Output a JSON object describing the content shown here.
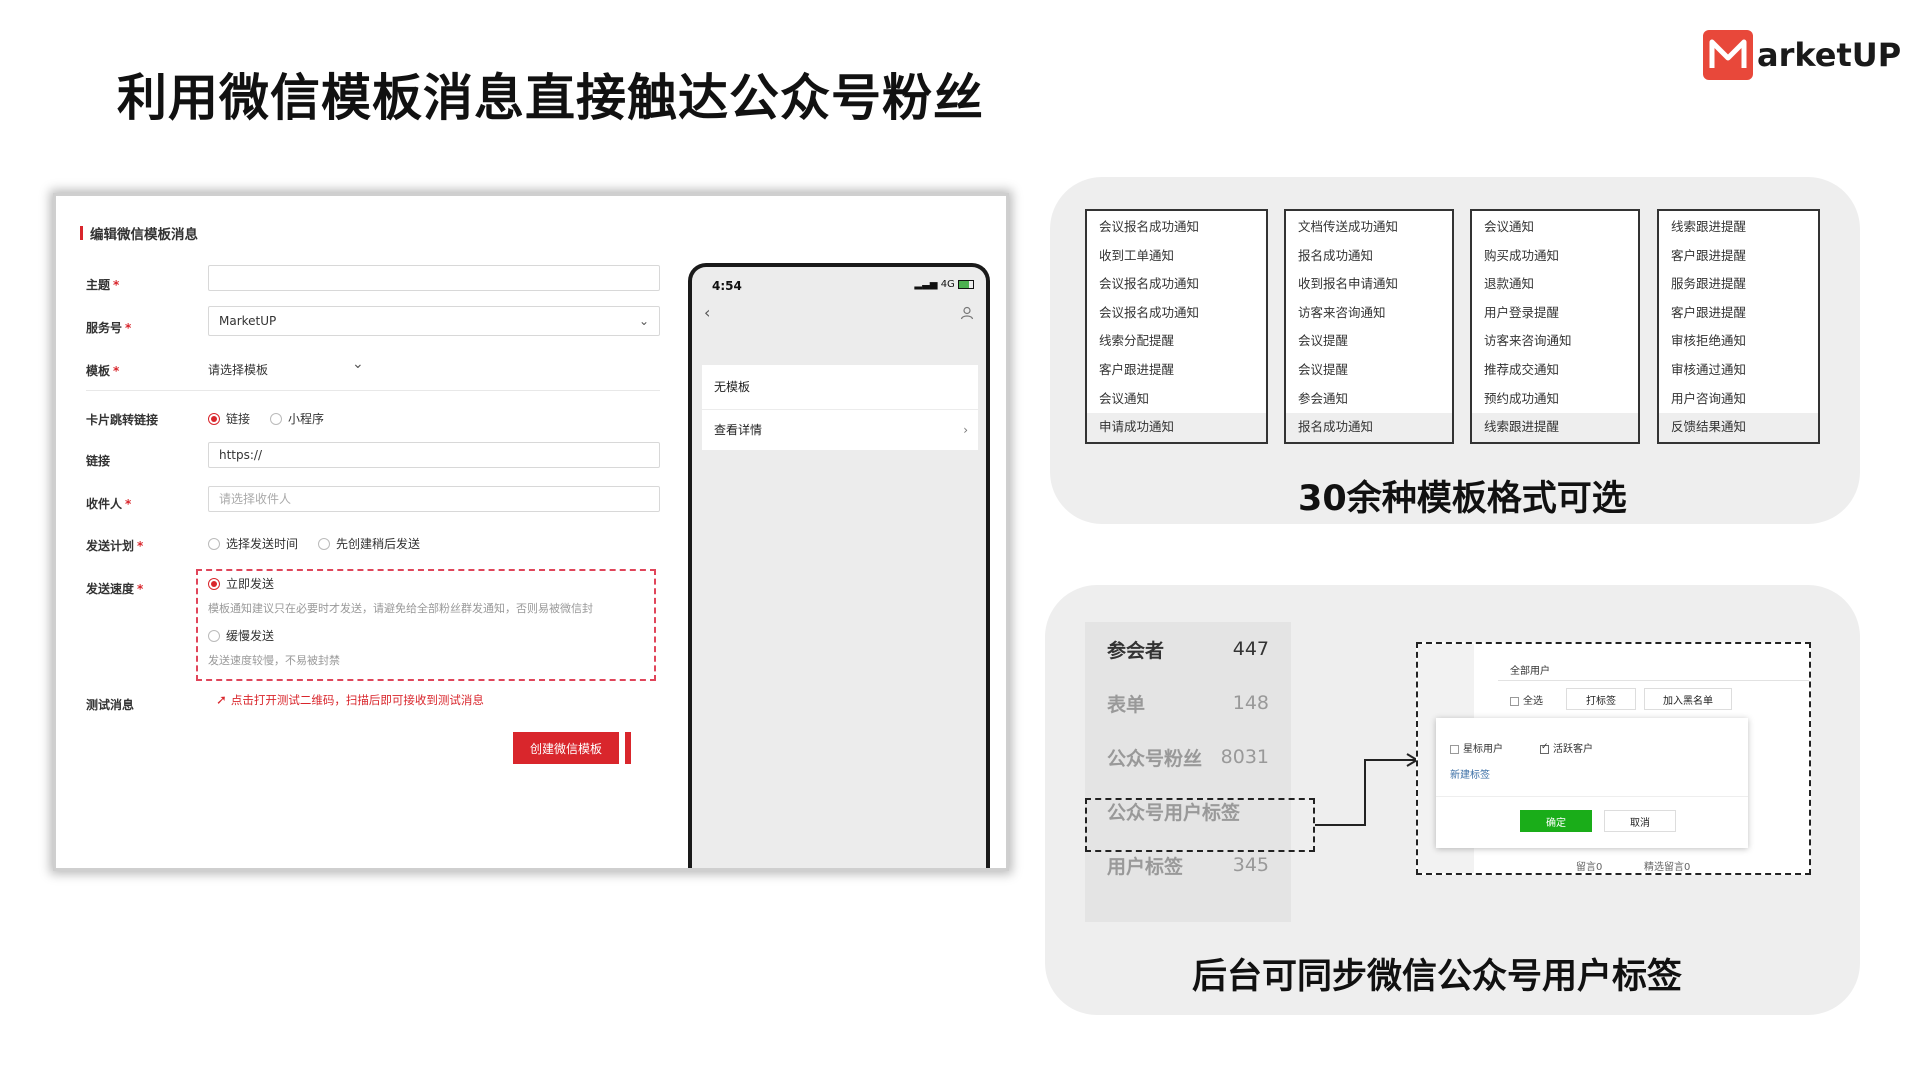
{
  "title": "利用微信模板消息直接触达公众号粉丝",
  "logo": {
    "text": "arketUP",
    "brand_color": "#e8483a"
  },
  "form": {
    "title": "编辑微信模板消息",
    "subject_label": "主题",
    "service_label": "服务号",
    "service_value": "MarketUP",
    "template_label": "模板",
    "template_value": "请选择模板",
    "jump_label": "卡片跳转链接",
    "jump_opt1": "链接",
    "jump_opt2": "小程序",
    "link_label": "链接",
    "link_value": "https://",
    "recipient_label": "收件人",
    "recipient_placeholder": "请选择收件人",
    "plan_label": "发送计划",
    "plan_opt1": "选择发送时间",
    "plan_opt2": "先创建稍后发送",
    "speed_label": "发送速度",
    "speed_opt1": "立即发送",
    "speed_hint1": "模板通知建议只在必要时才发送，请避免给全部粉丝群发通知，否则易被微信封",
    "speed_opt2": "缓慢发送",
    "speed_hint2": "发送速度较慢，不易被封禁",
    "test_label": "测试消息",
    "test_text": "点击打开测试二维码，扫描后即可接收到测试消息",
    "create_button": "创建微信模板",
    "accent_color": "#d9262c"
  },
  "phone": {
    "time": "4:54",
    "signal": "4G",
    "item1": "无模板",
    "item2": "查看详情"
  },
  "templates": {
    "columns": [
      [
        "会议报名成功通知",
        "收到工单通知",
        "会议报名成功通知",
        "会议报名成功通知",
        "线索分配提醒",
        "客户跟进提醒",
        "会议通知",
        "申请成功通知"
      ],
      [
        "文档传送成功通知",
        "报名成功通知",
        "收到报名申请通知",
        "访客来咨询通知",
        "会议提醒",
        "会议提醒",
        "参会通知",
        "报名成功通知"
      ],
      [
        "会议通知",
        "购买成功通知",
        "退款通知",
        "用户登录提醒",
        "访客来咨询通知",
        "推荐成交通知",
        "预约成功通知",
        "线索跟进提醒"
      ],
      [
        "线索跟进提醒",
        "客户跟进提醒",
        "服务跟进提醒",
        "客户跟进提醒",
        "审核拒绝通知",
        "审核通过通知",
        "用户咨询通知",
        "反馈结果通知"
      ]
    ],
    "caption": "30余种模板格式可选"
  },
  "stats": [
    {
      "label": "参会者",
      "value": "447"
    },
    {
      "label": "表单",
      "value": "148"
    },
    {
      "label": "公众号粉丝",
      "value": "8031"
    },
    {
      "label": "公众号用户标签",
      "value": ""
    },
    {
      "label": "用户标签",
      "value": "345"
    }
  ],
  "tag_dialog": {
    "header": "全部用户",
    "select_all": "全选",
    "tag_button": "打标签",
    "blacklist_button": "加入黑名单",
    "tag1": "星标用户",
    "tag2": "活跃客户",
    "new_tag": "新建标签",
    "confirm": "确定",
    "cancel": "取消",
    "foot1": "留言0",
    "foot2": "精选留言0"
  },
  "sync_caption": "后台可同步微信公众号用户标签"
}
